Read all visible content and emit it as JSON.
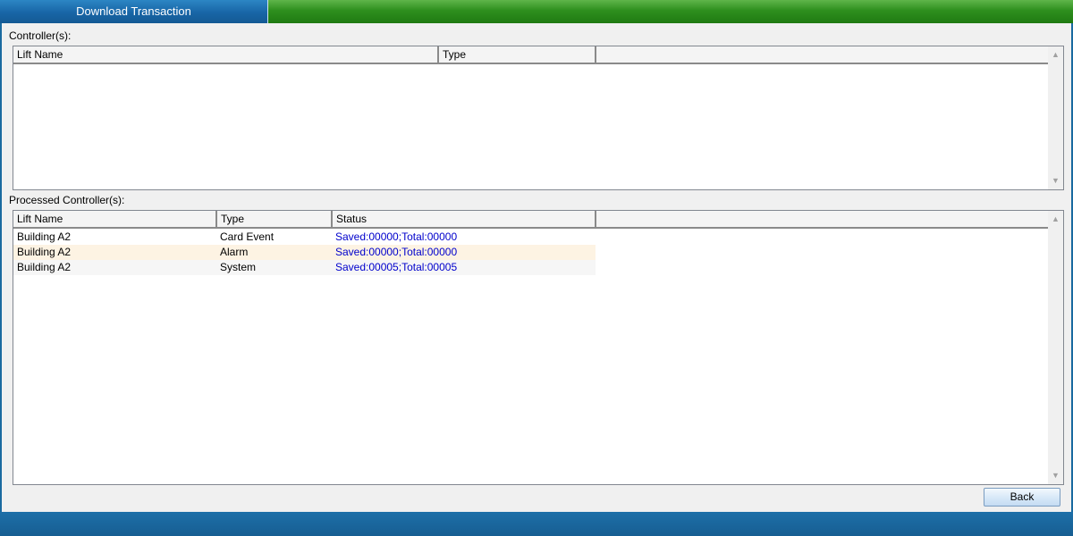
{
  "window": {
    "tab_title": "Download Transaction"
  },
  "controllers": {
    "label": "Controller(s):",
    "columns": [
      "Lift Name",
      "Type"
    ],
    "rows": []
  },
  "processed": {
    "label": "Processed Controller(s):",
    "columns": [
      "Lift Name",
      "Type",
      "Status"
    ],
    "rows": [
      {
        "lift_name": "Building A2",
        "type": "Card Event",
        "status": "Saved:00000;Total:00000"
      },
      {
        "lift_name": "Building A2",
        "type": "Alarm",
        "status": "Saved:00000;Total:00000"
      },
      {
        "lift_name": "Building A2",
        "type": "System",
        "status": "Saved:00005;Total:00005"
      }
    ]
  },
  "footer": {
    "back_label": "Back"
  },
  "colors": {
    "status_text": "#0000cc",
    "row_alt_highlight": "#fdf3e3",
    "row_alt": "#f6f6f6",
    "topbar_green": "#2e8f1e",
    "tab_blue": "#1865a6"
  }
}
